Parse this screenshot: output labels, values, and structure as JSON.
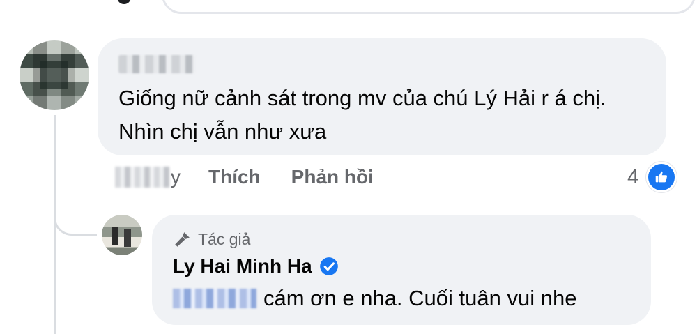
{
  "comment": {
    "text": "Giống nữ cảnh sát trong mv của chú Lý Hải r á chị. Nhìn chị vẫn như xưa",
    "time_suffix": "y",
    "actions": {
      "like_label": "Thích",
      "reply_label": "Phản hồi"
    },
    "reaction_count": "4",
    "reaction_icon": "like-thumb-icon"
  },
  "reply": {
    "author_badge": "Tác giả",
    "author_name": "Ly Hai Minh Ha",
    "verified": true,
    "text": "cám ơn e nha. Cuối tuân vui nhe"
  },
  "colors": {
    "bubble": "#f0f2f5",
    "secondary_text": "#65676b",
    "facebook_blue": "#1877f2"
  }
}
